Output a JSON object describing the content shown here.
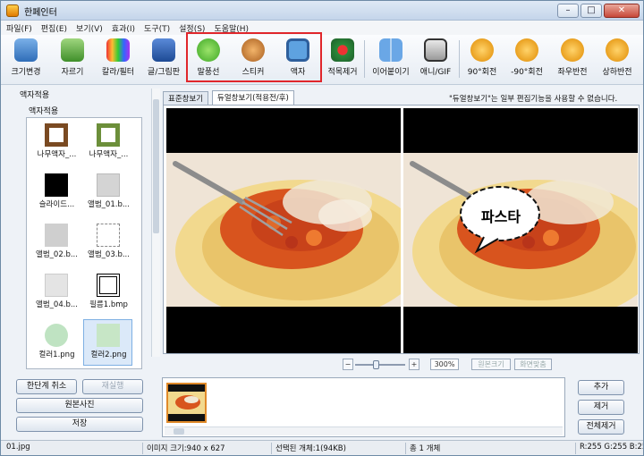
{
  "window": {
    "title": "한페인터"
  },
  "menu": [
    "파일(F)",
    "편집(E)",
    "보기(V)",
    "효과(I)",
    "도구(T)",
    "설정(S)",
    "도움말(H)"
  ],
  "toolbar": {
    "resize": "크기변경",
    "crop": "자르기",
    "color_filter": "칼라/필터",
    "text_image": "글/그림판",
    "speech_bubble": "말풍선",
    "sticker": "스티커",
    "frame": "액자",
    "redeye": "적목제거",
    "join": "이어붙이기",
    "gif": "애니/GIF",
    "rotate_cw": "90°회전",
    "rotate_ccw": "-90°회전",
    "flip_h": "좌우반전",
    "flip_v": "상하반전"
  },
  "left_panel": {
    "title": "액자적용",
    "subtitle": "액자적용",
    "thumbs": [
      {
        "label": "나무액자_..."
      },
      {
        "label": "나무액자_..."
      },
      {
        "label": "슬라이드..."
      },
      {
        "label": "앨범_01.b..."
      },
      {
        "label": "앨범_02.b..."
      },
      {
        "label": "앨범_03.b..."
      },
      {
        "label": "앨범_04.b..."
      },
      {
        "label": "필름1.bmp"
      },
      {
        "label": "컬러1.png"
      },
      {
        "label": "컬러2.png"
      }
    ]
  },
  "tabs": {
    "standard": "표준창보기",
    "dual": "듀얼창보기(적용전/후)",
    "note": "\"듀얼창보기\"는 일부 편집기능을 사용할 수 없습니다."
  },
  "preview": {
    "bubble_text": "파스타"
  },
  "zoom": {
    "value": "300%",
    "original_size": "원본크기",
    "fit_screen": "화면맞춤"
  },
  "actions": {
    "undo": "한단계 취소",
    "redo": "재실행",
    "original": "원본사진",
    "save": "저장"
  },
  "list_buttons": {
    "add": "추가",
    "remove": "제거",
    "remove_all": "전체제거"
  },
  "status": {
    "file": "01.jpg",
    "size": "이미지 크기:940 x 627",
    "selected": "선택된 개체:1(94KB)",
    "total": "총 1 개체",
    "rgb": "R:255 G:255 B:255"
  },
  "colors": {
    "accent_red": "#e0262b",
    "window_border": "#6e8ba6",
    "bg": "#eef2f7"
  }
}
